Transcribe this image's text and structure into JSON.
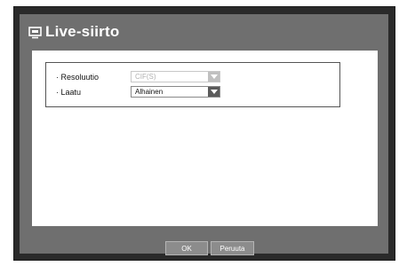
{
  "dialog": {
    "title": "Live-siirto",
    "title_icon": "monitor-icon"
  },
  "settings": {
    "rows": [
      {
        "label": "· Resoluutio",
        "value": "CIF(S)",
        "enabled": false
      },
      {
        "label": "· Laatu",
        "value": "Alhainen",
        "enabled": true
      }
    ]
  },
  "footer": {
    "ok_label": "OK",
    "cancel_label": "Peruuta"
  },
  "colors": {
    "frame": "#2a2a2a",
    "dialog_bg": "#6f6f6f",
    "button_bg": "#8c8c8c"
  }
}
